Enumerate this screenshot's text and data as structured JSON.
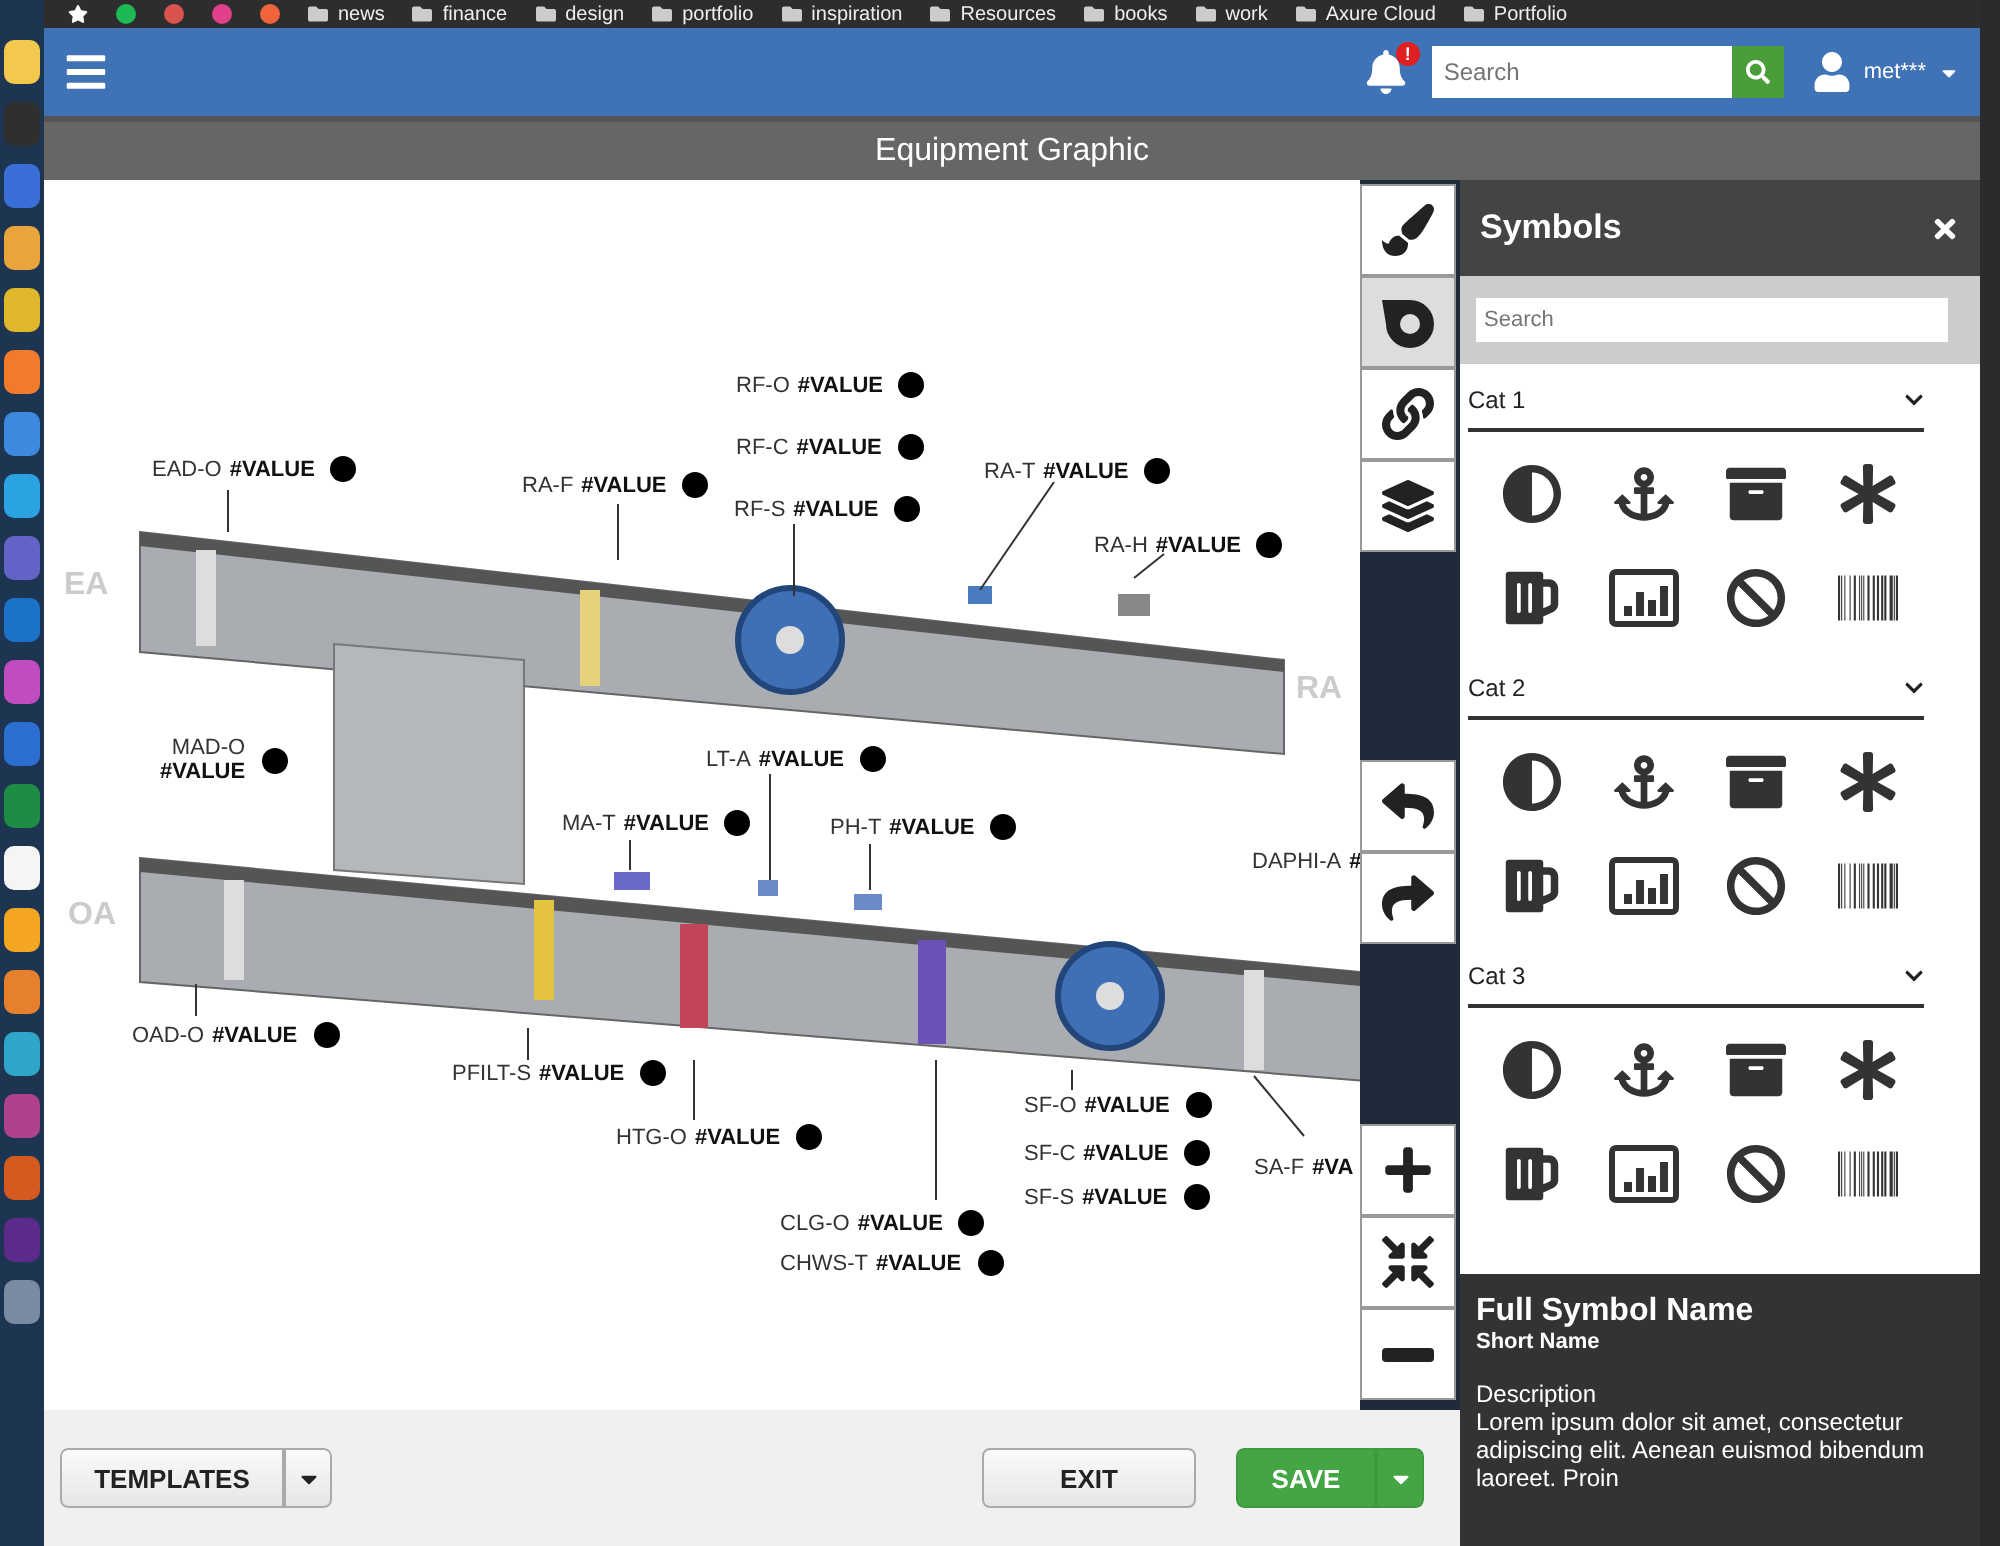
{
  "bookmarks": [
    "news",
    "finance",
    "design",
    "portfolio",
    "inspiration",
    "Resources",
    "books",
    "work",
    "Axure Cloud",
    "Portfolio"
  ],
  "app_bar": {
    "notification_badge": "!",
    "search": {
      "placeholder": "Search"
    },
    "user": "met***"
  },
  "title": "Equipment Graphic",
  "diagram": {
    "zones": [
      "EA",
      "RA",
      "OA"
    ],
    "points": [
      {
        "name": "EAD-O",
        "value": "#VALUE",
        "kind": "inline",
        "dot": true
      },
      {
        "name": "RA-F",
        "value": "#VALUE",
        "kind": "inline",
        "dot": true
      },
      {
        "name": "RF-O",
        "value": "#VALUE",
        "kind": "inline",
        "dot": true
      },
      {
        "name": "RF-C",
        "value": "#VALUE",
        "kind": "inline",
        "dot": true
      },
      {
        "name": "RF-S",
        "value": "#VALUE",
        "kind": "inline",
        "dot": true
      },
      {
        "name": "RA-T",
        "value": "#VALUE",
        "kind": "inline",
        "dot": true
      },
      {
        "name": "RA-H",
        "value": "#VALUE",
        "kind": "inline",
        "dot": true
      },
      {
        "name": "MAD-O",
        "value": "#VALUE",
        "kind": "stacked",
        "dot": true
      },
      {
        "name": "LT-A",
        "value": "#VALUE",
        "kind": "inline",
        "dot": true
      },
      {
        "name": "MA-T",
        "value": "#VALUE",
        "kind": "inline",
        "dot": true
      },
      {
        "name": "PH-T",
        "value": "#VALUE",
        "kind": "inline",
        "dot": true
      },
      {
        "name": "DAPHI-A",
        "value": "#",
        "kind": "inline",
        "dot": false
      },
      {
        "name": "OAD-O",
        "value": "#VALUE",
        "kind": "inline",
        "dot": true
      },
      {
        "name": "PFILT-S",
        "value": "#VALUE",
        "kind": "inline",
        "dot": true
      },
      {
        "name": "HTG-O",
        "value": "#VALUE",
        "kind": "inline",
        "dot": true
      },
      {
        "name": "SF-O",
        "value": "#VALUE",
        "kind": "inline",
        "dot": true
      },
      {
        "name": "SF-C",
        "value": "#VALUE",
        "kind": "inline",
        "dot": true
      },
      {
        "name": "SF-S",
        "value": "#VALUE",
        "kind": "inline",
        "dot": true
      },
      {
        "name": "SA-F",
        "value": "#VA",
        "kind": "inline",
        "dot": false
      },
      {
        "name": "CLG-O",
        "value": "#VALUE",
        "kind": "inline",
        "dot": true
      },
      {
        "name": "CHWS-T",
        "value": "#VALUE",
        "kind": "inline",
        "dot": true
      }
    ]
  },
  "tools": [
    {
      "selected": false
    },
    {
      "selected": true
    },
    {
      "selected": false
    },
    {
      "selected": false
    }
  ],
  "symbols_panel": {
    "title": "Symbols",
    "search": {
      "placeholder": "Search"
    },
    "categories": [
      {
        "name": "Cat 1",
        "expanded": true
      },
      {
        "name": "Cat 2",
        "expanded": true
      },
      {
        "name": "Cat 3",
        "expanded": true
      }
    ]
  },
  "info": {
    "title": "Full Symbol Name",
    "short_name": "Short Name",
    "description_label": "Description",
    "description": "Lorem ipsum dolor sit amet, consectetur adipiscing elit. Aenean euismod bibendum laoreet. Proin"
  },
  "footer": {
    "templates": "TEMPLATES",
    "exit": "EXIT",
    "save": "SAVE"
  }
}
